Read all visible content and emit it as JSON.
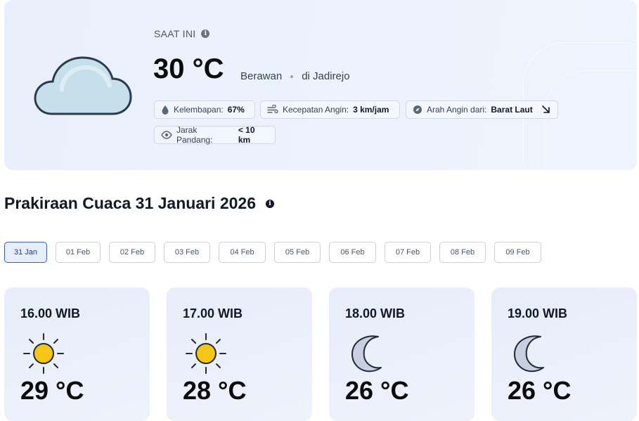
{
  "current": {
    "label": "SAAT INI",
    "temperature": "30 °C",
    "condition": "Berawan",
    "location": "di Jadirejo",
    "icon": "cloud-icon",
    "humidity": {
      "label": "Kelembapan:",
      "value": "67%",
      "icon": "water-drop-icon"
    },
    "wind_speed": {
      "label": "Kecepatan Angin:",
      "value": "3 km/jam",
      "icon": "wind-icon"
    },
    "wind_direction": {
      "label": "Arah Angin dari:",
      "value": "Barat Laut",
      "icon": "compass-icon"
    },
    "visibility": {
      "label": "Jarak Pandang:",
      "value": "< 10 km",
      "icon": "eye-icon"
    }
  },
  "forecast": {
    "title": "Prakiraan Cuaca 31 Januari 2026",
    "tabs": [
      "31 Jan",
      "01 Feb",
      "02 Feb",
      "03 Feb",
      "04 Feb",
      "05 Feb",
      "06 Feb",
      "07 Feb",
      "08 Feb",
      "09 Feb"
    ],
    "active_tab": "31 Jan",
    "hours": [
      {
        "time": "16.00 WIB",
        "temp": "29 °C",
        "icon": "sun-icon"
      },
      {
        "time": "17.00 WIB",
        "temp": "28 °C",
        "icon": "sun-icon"
      },
      {
        "time": "18.00 WIB",
        "temp": "26 °C",
        "icon": "moon-icon"
      },
      {
        "time": "19.00 WIB",
        "temp": "26 °C",
        "icon": "moon-icon"
      }
    ]
  },
  "colors": {
    "accent": "#3b5bbf",
    "card_bg": "#eaf0fb",
    "sun": "#f5c518",
    "moon": "#c9cfe0"
  }
}
